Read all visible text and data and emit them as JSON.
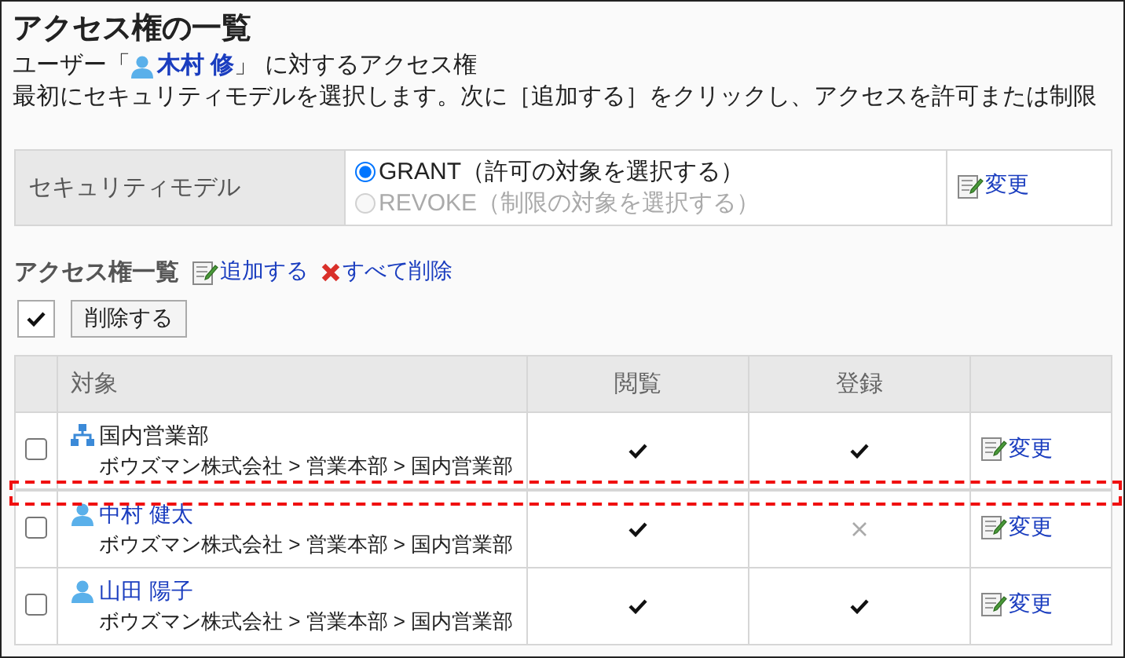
{
  "title": "アクセス権の一覧",
  "user_line": {
    "prefix": "ユーザー「",
    "user": "木村 修",
    "suffix": "」 に対するアクセス権"
  },
  "instruction": "最初にセキュリティモデルを選択します。次に［追加する］をクリックし、アクセスを許可または制限",
  "security_model": {
    "label": "セキュリティモデル",
    "options": [
      {
        "label": "GRANT（許可の対象を選択する）",
        "selected": true,
        "disabled": false
      },
      {
        "label": "REVOKE（制限の対象を選択する）",
        "selected": false,
        "disabled": true
      }
    ],
    "action": "変更"
  },
  "section": {
    "title": "アクセス権一覧",
    "add": "追加する",
    "delete_all": "すべて削除"
  },
  "toolbar": {
    "delete": "削除する"
  },
  "table": {
    "columns": [
      "対象",
      "閲覧",
      "登録"
    ],
    "rows": [
      {
        "kind": "group",
        "name": "国内営業部",
        "path": "ボウズマン株式会社 > 営業本部 > 国内営業部",
        "checked": false,
        "view": true,
        "register": true,
        "action": "変更",
        "highlight_below": true
      },
      {
        "kind": "user",
        "name": "中村 健太",
        "path": "ボウズマン株式会社 > 営業本部 > 国内営業部",
        "checked": false,
        "view": true,
        "register": false,
        "action": "変更",
        "highlight_below": false
      },
      {
        "kind": "user",
        "name": "山田 陽子",
        "path": "ボウズマン株式会社 > 営業本部 > 国内営業部",
        "checked": false,
        "view": true,
        "register": true,
        "action": "変更",
        "highlight_below": false
      }
    ]
  }
}
